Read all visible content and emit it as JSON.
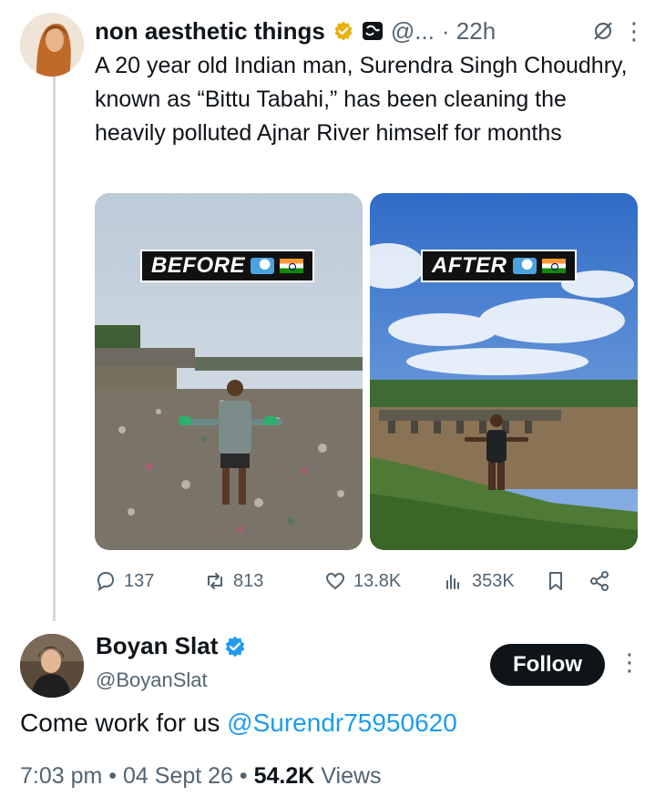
{
  "tweet": {
    "author_name": "non aesthetic things",
    "handle": "@...",
    "time": "· 22h",
    "text": "A 20 year old Indian man, Surendra Singh Choudhry, known as “Bittu Tabahi,” has been cleaning the heavily polluted Ajnar River himself for months",
    "media": {
      "before_label": "BEFORE",
      "after_label": "AFTER"
    },
    "actions": {
      "replies": "137",
      "reposts": "813",
      "likes": "13.8K",
      "views": "353K"
    }
  },
  "reply": {
    "author_name": "Boyan Slat",
    "handle": "@BoyanSlat",
    "follow_label": "Follow",
    "text_prefix": "Come work for us ",
    "mention": "@Surendr75950620",
    "time": "7:03 pm",
    "date": "04 Sept 26",
    "views_count": "54.2K",
    "views_label": "Views"
  },
  "colors": {
    "accent": "#1d9bf0",
    "text_primary": "#0f1419",
    "text_secondary": "#536471",
    "verified_gold": "#e9b10f",
    "verified_blue": "#1d9bf0"
  }
}
